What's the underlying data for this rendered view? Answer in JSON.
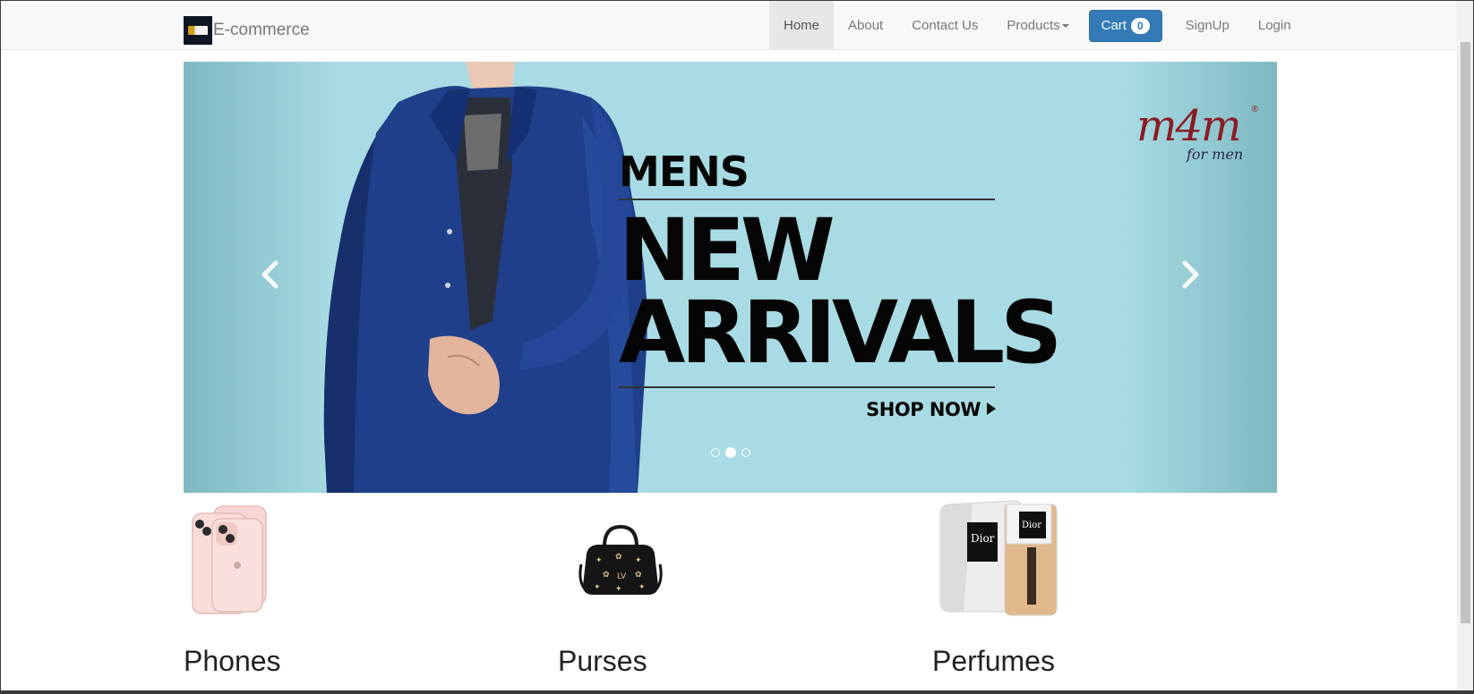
{
  "navbar": {
    "brand": "E-commerce",
    "items": [
      {
        "label": "Home"
      },
      {
        "label": "About"
      },
      {
        "label": "Contact Us"
      },
      {
        "label": "Products"
      },
      {
        "label": "SignUp"
      },
      {
        "label": "Login"
      }
    ],
    "cart": {
      "label": "Cart",
      "count": "0"
    }
  },
  "carousel": {
    "slide": {
      "line1": "MENS",
      "line2": "NEW",
      "line3": "ARRIVALS",
      "cta": "SHOP NOW",
      "logo_main": "m4m",
      "logo_sub": "for men",
      "logo_reg": "®"
    },
    "indicator_count": 3,
    "active_indicator": 2
  },
  "products": [
    {
      "title": "Phones"
    },
    {
      "title": "Purses"
    },
    {
      "title": "Perfumes"
    }
  ],
  "colors": {
    "primary": "#337ab7",
    "banner_bg": "#a8dbe3",
    "jacket": "#1f3f8a",
    "logo_red": "#c91a22"
  },
  "icons": {
    "prev": "chevron-left-icon",
    "next": "chevron-right-icon"
  }
}
